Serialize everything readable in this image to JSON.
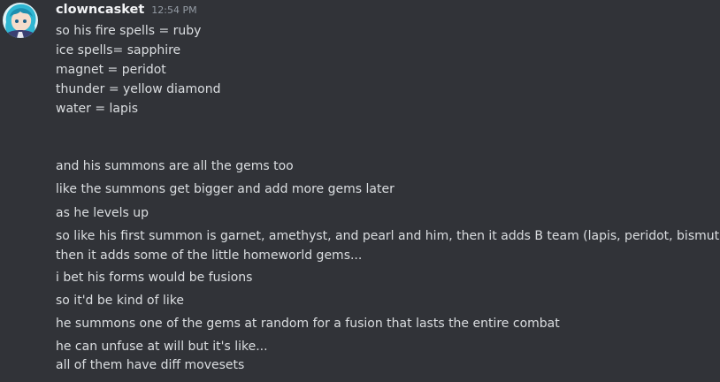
{
  "message": {
    "username": "clowncasket",
    "timestamp": "12:54 PM",
    "avatar_icon": "anime-character-avatar-icon",
    "accent_color": "#f2f3f5",
    "lines": [
      "so his fire spells = ruby",
      "ice spells= sapphire",
      "magnet = peridot",
      "thunder = yellow diamond",
      "water = lapis",
      "and his summons are all the gems too",
      "like the summons get bigger and add more gems later",
      "as he levels up",
      "so like his first summon is garnet, amethyst, and pearl and him, then it adds B team (lapis, peridot, bismuth)",
      "then it adds some of the little homeworld gems...",
      "i bet his forms would be fusions",
      "so it'd be kind of like",
      "he summons one of the gems at random for a fusion that lasts the entire combat",
      "he can unfuse at will but it's like...",
      "all of them have diff movesets"
    ]
  }
}
